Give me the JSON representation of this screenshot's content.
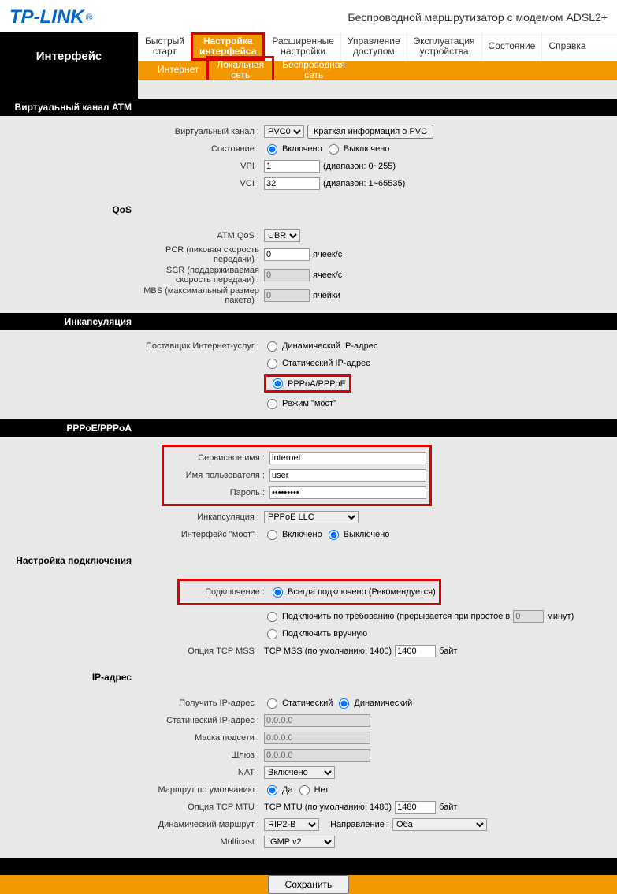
{
  "header": {
    "logo": "TP-LINK",
    "subtitle": "Беспроводной маршрутизатор с модемом ADSL2+"
  },
  "nav": {
    "side_title": "Интерфейс",
    "top": [
      "Быстрый\nстарт",
      "Настройка\nинтерфейса",
      "Расширенные\nнастройки",
      "Управление\nдоступом",
      "Эксплуатация\nустройства",
      "Состояние",
      "Справка"
    ],
    "sub": [
      "Интернет",
      "Локальная\nсеть",
      "Беспроводная\nсеть"
    ]
  },
  "sections": {
    "atm": "Виртуальный канал ATM",
    "qos": "QoS",
    "encap": "Инкапсуляция",
    "pppoe": "PPPoE/PPPoA",
    "conn": "Настройка подключения",
    "ip": "IP-адрес"
  },
  "atm": {
    "vc_label": "Виртуальный канал :",
    "vc_value": "PVC0",
    "pvc_btn": "Краткая информация о PVC",
    "state_label": "Состояние :",
    "state_on": "Включено",
    "state_off": "Выключено",
    "vpi_label": "VPI :",
    "vpi_value": "1",
    "vpi_hint": "(диапазон: 0~255)",
    "vci_label": "VCI :",
    "vci_value": "32",
    "vci_hint": "(диапазон: 1~65535)"
  },
  "qos": {
    "qos_label": "ATM QoS :",
    "qos_value": "UBR",
    "pcr_label": "PCR (пиковая скорость передачи) :",
    "pcr_value": "0",
    "pcr_unit": "ячеек/с",
    "scr_label": "SCR (поддерживаемая скорость передачи) :",
    "scr_value": "0",
    "scr_unit": "ячеек/с",
    "mbs_label": "MBS (максимальный размер пакета) :",
    "mbs_value": "0",
    "mbs_unit": "ячейки"
  },
  "isp": {
    "label": "Поставщик Интернет-услуг :",
    "dyn": "Динамический IP-адрес",
    "stat": "Статический IP-адрес",
    "ppp": "PPPoA/PPPoE",
    "bridge": "Режим \"мост\""
  },
  "ppp": {
    "svc_label": "Сервисное имя :",
    "svc_value": "internet",
    "user_label": "Имя пользователя :",
    "user_value": "user",
    "pass_label": "Пароль :",
    "pass_value": "•••••••••",
    "encap_label": "Инкапсуляция :",
    "encap_value": "PPPoE LLC",
    "bridge_label": "Интерфейс \"мост\" :",
    "bridge_on": "Включено",
    "bridge_off": "Выключено"
  },
  "conn": {
    "conn_label": "Подключение :",
    "always": "Всегда подключено (Рекомендуется)",
    "ondemand": "Подключить по требованию (прерывается при простое в",
    "ondemand_val": "0",
    "ondemand_unit": "минут)",
    "manual": "Подключить вручную",
    "mss_label": "Опция TCP MSS :",
    "mss_text": "TCP MSS (по умолчанию: 1400)",
    "mss_value": "1400",
    "mss_unit": "байт"
  },
  "ip": {
    "get_label": "Получить IP-адрес :",
    "stat": "Статический",
    "dyn": "Динамический",
    "static_label": "Статический IP-адрес :",
    "static_value": "0.0.0.0",
    "mask_label": "Маска подсети :",
    "mask_value": "0.0.0.0",
    "gw_label": "Шлюз :",
    "gw_value": "0.0.0.0",
    "nat_label": "NAT :",
    "nat_value": "Включено",
    "defroute_label": "Маршрут по умолчанию :",
    "yes": "Да",
    "no": "Нет",
    "mtu_label": "Опция TCP MTU :",
    "mtu_text": "TCP MTU (по умолчанию: 1480)",
    "mtu_value": "1480",
    "mtu_unit": "байт",
    "rip_label": "Динамический маршрут :",
    "rip_value": "RIP2-B",
    "dir_label": "Направление :",
    "dir_value": "Оба",
    "mcast_label": "Multicast :",
    "mcast_value": "IGMP v2"
  },
  "footer": {
    "save": "Сохранить"
  }
}
